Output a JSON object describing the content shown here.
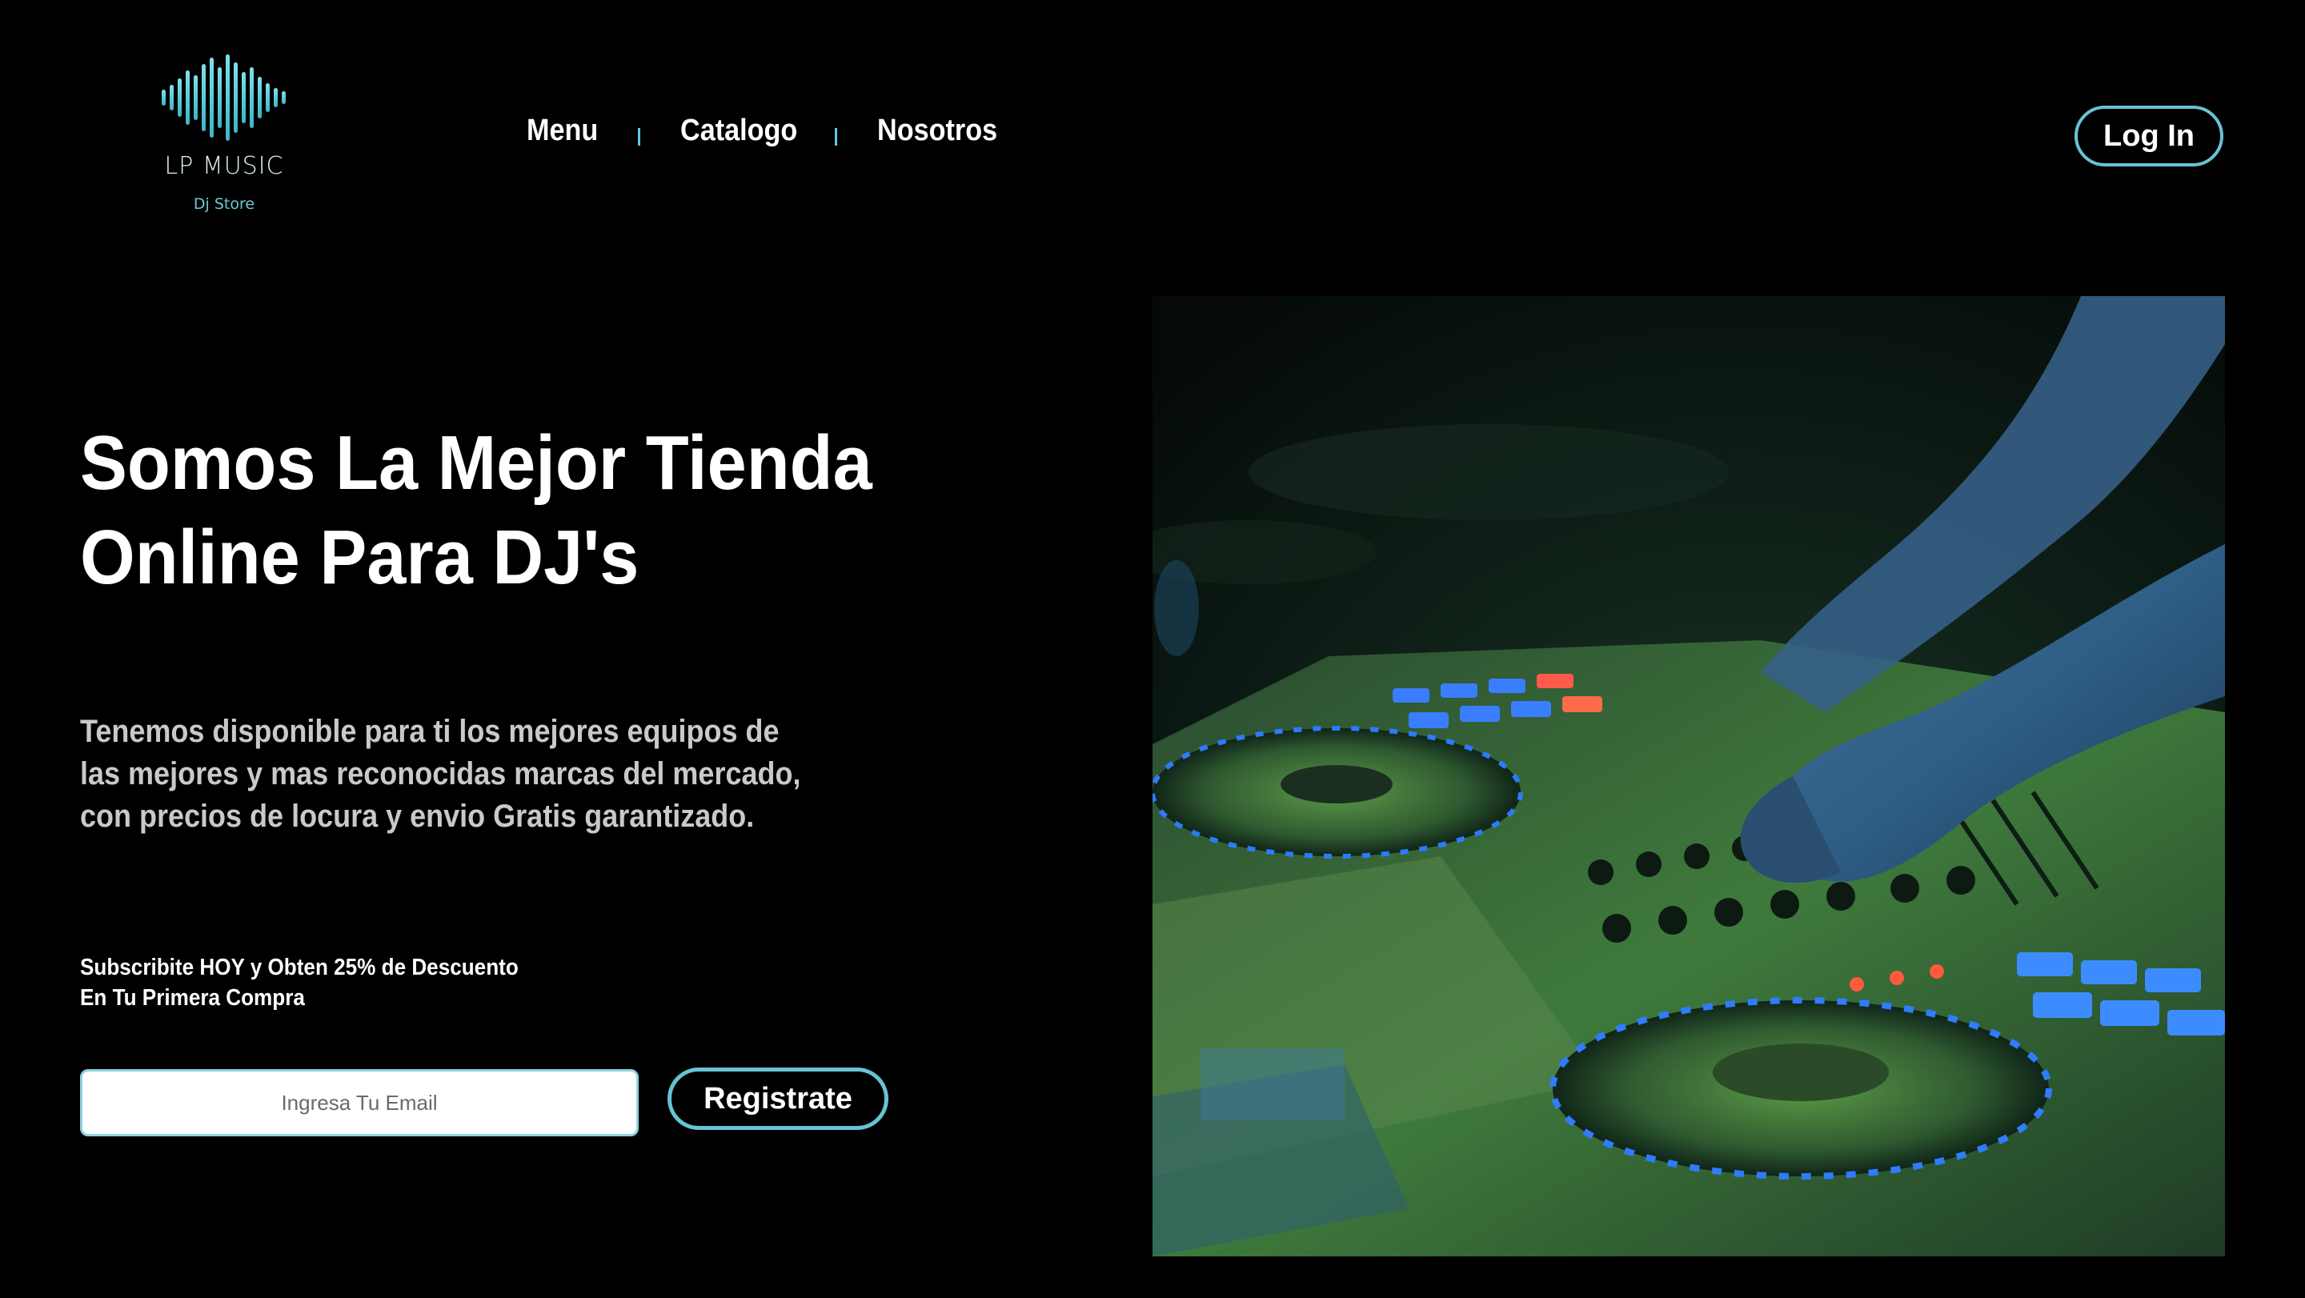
{
  "brand": {
    "name": "LP MUSIC",
    "tagline": "Dj Store",
    "accent_color": "#67c2d4",
    "logo_icon": "soundwave-icon"
  },
  "nav": {
    "items": [
      {
        "label": "Menu"
      },
      {
        "label": "Catalogo"
      },
      {
        "label": "Nosotros"
      }
    ],
    "separator_color": "#5fc9de"
  },
  "header": {
    "login_label": "Log In"
  },
  "hero": {
    "title_line1": "Somos La Mejor Tienda",
    "title_line2": "Online Para DJ's",
    "description_line1": "Tenemos disponible para ti los mejores equipos de",
    "description_line2": "las mejores y mas reconocidas marcas del mercado,",
    "description_line3": "con precios de locura y envio Gratis garantizado.",
    "image_subject": "dj-controller-photo"
  },
  "subscribe": {
    "promo_line1": "Subscribite HOY y Obten 25% de Descuento",
    "promo_line2": "En Tu Primera Compra",
    "email_value": "",
    "email_placeholder": "Ingresa Tu Email",
    "register_label": "Registrate"
  }
}
